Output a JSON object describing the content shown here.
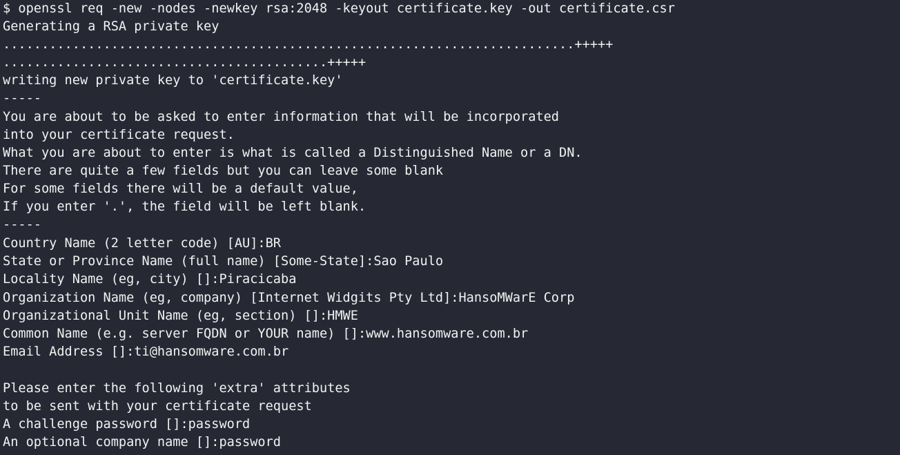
{
  "terminal": {
    "lines": [
      "$ openssl req -new -nodes -newkey rsa:2048 -keyout certificate.key -out certificate.csr",
      "Generating a RSA private key",
      "..........................................................................+++++",
      "..........................................+++++",
      "writing new private key to 'certificate.key'",
      "-----",
      "You are about to be asked to enter information that will be incorporated",
      "into your certificate request.",
      "What you are about to enter is what is called a Distinguished Name or a DN.",
      "There are quite a few fields but you can leave some blank",
      "For some fields there will be a default value,",
      "If you enter '.', the field will be left blank.",
      "-----",
      "Country Name (2 letter code) [AU]:BR",
      "State or Province Name (full name) [Some-State]:Sao Paulo",
      "Locality Name (eg, city) []:Piracicaba",
      "Organization Name (eg, company) [Internet Widgits Pty Ltd]:HansoMWarE Corp",
      "Organizational Unit Name (eg, section) []:HMWE",
      "Common Name (e.g. server FQDN or YOUR name) []:www.hansomware.com.br",
      "Email Address []:ti@hansomware.com.br",
      "",
      "Please enter the following 'extra' attributes",
      "to be sent with your certificate request",
      "A challenge password []:password",
      "An optional company name []:password"
    ]
  }
}
